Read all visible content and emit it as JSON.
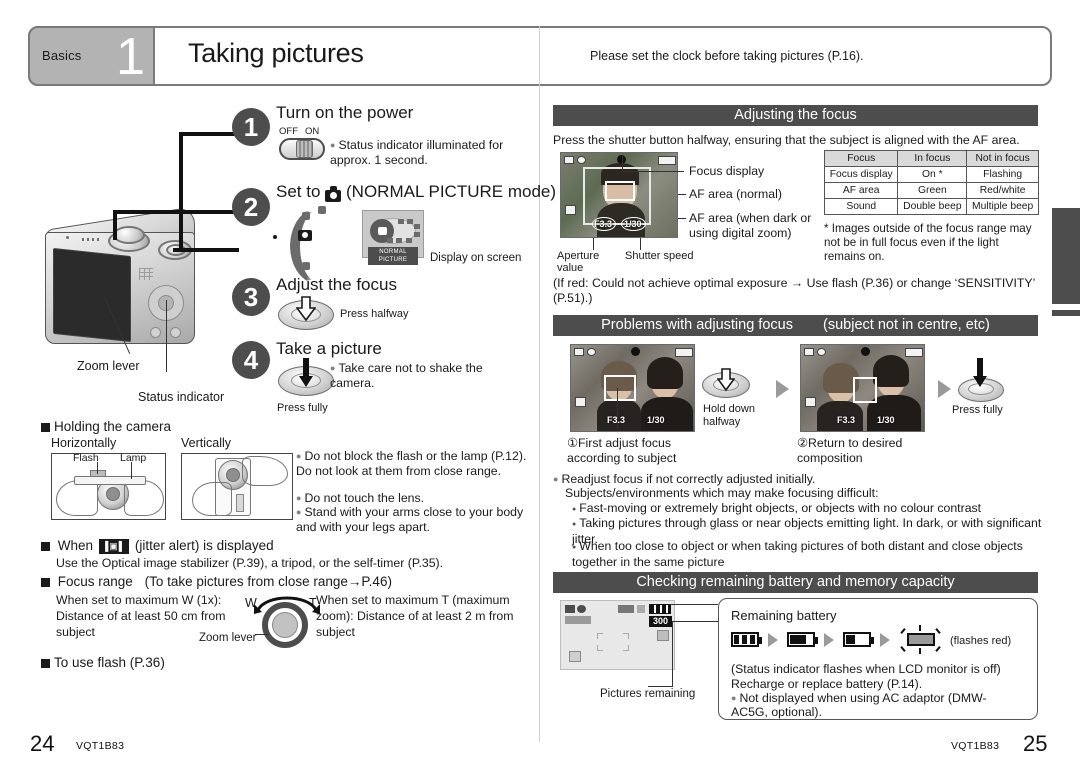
{
  "header": {
    "chapter_label": "Basics",
    "chapter_number": "1",
    "title": "Taking pictures",
    "note": "Please set the clock before taking pictures (P.16)."
  },
  "left_page": {
    "steps": [
      {
        "number": "1",
        "title": "Turn on the power",
        "switch_off": "OFF",
        "switch_on": "ON",
        "bullet": "Status indicator illuminated for approx. 1 second."
      },
      {
        "number": "2",
        "title_prefix": "Set to",
        "title_suffix": "(NORMAL PICTURE mode)",
        "mode_badge": "NORMAL PICTURE",
        "screen_caption": "Display on screen"
      },
      {
        "number": "3",
        "title": "Adjust the focus",
        "press_caption": "Press halfway"
      },
      {
        "number": "4",
        "title": "Take a picture",
        "press_caption": "Press fully",
        "bullet": "Take care not to shake the camera."
      }
    ],
    "camera_labels": {
      "zoom_lever": "Zoom lever",
      "status_indicator": "Status indicator"
    },
    "holding": {
      "heading": "Holding the camera",
      "horizontally": "Horizontally",
      "vertically": "Vertically",
      "flash_label": "Flash",
      "lamp_label": "Lamp",
      "bullets": [
        "Do not block the flash or the lamp (P.12). Do not look at them from close range.",
        "Do not touch the lens.",
        "Stand with your arms close to your body and with your legs apart."
      ]
    },
    "jitter": {
      "heading_before": "When",
      "glyph": "jitter-alert-icon",
      "heading_after": "(jitter alert) is displayed",
      "body": "Use the Optical image stabilizer (P.39), a tripod, or the self-timer (P.35)."
    },
    "focus_range": {
      "heading": "Focus range",
      "heading_note": "(To take pictures from close range→P.46)",
      "left_text": "When set to maximum W (1x): Distance of at least 50 cm from subject",
      "right_text": "When set to maximum T (maximum zoom): Distance of at least 2 m from subject",
      "w_label": "W",
      "t_label": "T",
      "lever_label": "Zoom lever"
    },
    "flash_heading": "To use flash (P.36)"
  },
  "right_page": {
    "adjusting_focus": {
      "heading": "Adjusting the focus",
      "intro": "Press the shutter button halfway, ensuring that the subject is aligned with the AF area.",
      "callouts": [
        "Focus display",
        "AF area (normal)",
        "AF area (when dark or using digital zoom)"
      ],
      "aperture_label": "Aperture value",
      "shutter_label": "Shutter speed",
      "aperture_value": "F3.3",
      "shutter_value": "1/30",
      "table": {
        "headers": [
          "Focus",
          "In focus",
          "Not in focus"
        ],
        "rows": [
          [
            "Focus display",
            "On *",
            "Flashing"
          ],
          [
            "AF area",
            "Green",
            "Red/white"
          ],
          [
            "Sound",
            "Double beep",
            "Multiple beep"
          ]
        ]
      },
      "footnote": "* Images outside of the focus range may not be in full focus even if the light remains on.",
      "red_note": "(If red: Could not achieve optimal exposure → Use flash (P.36) or change ‘SENSITIVITY’ (P.51).)"
    },
    "problems": {
      "heading": "Problems with adjusting focus",
      "heading_sub": "(subject not in centre, etc)",
      "step1_caption": "①First adjust focus according to subject",
      "step1_action": "Hold down halfway",
      "step2_caption": "②Return to desired composition",
      "step2_action": "Press fully",
      "shot_aperture": "F3.3",
      "shot_shutter": "1/30",
      "bullets": [
        "Readjust focus if not correctly adjusted initially.",
        "Subjects/environments which may make focusing difficult:"
      ],
      "sub_bullets": [
        "Fast-moving or extremely bright objects, or objects with no colour contrast",
        "Taking pictures through glass or near objects emitting light. In dark, or with significant jitter.",
        "When too close to object or when taking pictures of both distant and close objects together in the same picture"
      ]
    },
    "battery": {
      "heading": "Checking remaining battery and memory capacity",
      "remaining_battery_label": "Remaining battery",
      "pictures_remaining_label": "Pictures remaining",
      "pictures_remaining_value": "300",
      "flashes_red": "(flashes red)",
      "notes": [
        "(Status indicator flashes when LCD monitor is off)",
        "Recharge or replace battery (P.14)."
      ],
      "bullet": "Not displayed when using AC adaptor (DMW-AC5G, optional)."
    }
  },
  "footer": {
    "left_page_number": "24",
    "left_code": "VQT1B83",
    "right_code": "VQT1B83",
    "right_page_number": "25"
  },
  "colors": {
    "section_header_bg": "#4d4d4d",
    "chapter_tab_bg": "#b3b3b3",
    "text": "#1a1a1a"
  }
}
